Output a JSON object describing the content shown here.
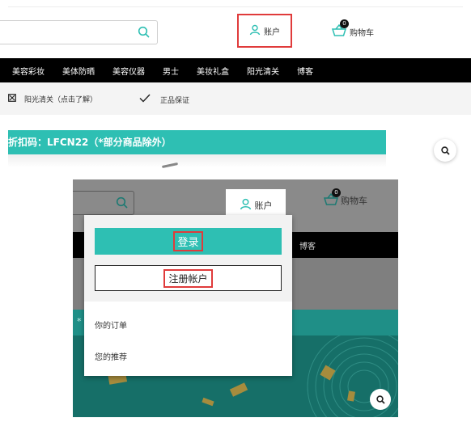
{
  "top": {
    "account_label": "账户",
    "cart_label": "购物车",
    "cart_count": "0",
    "nav_items": [
      "美容彩妆",
      "美体防晒",
      "美容仪器",
      "男士",
      "美妆礼盒",
      "阳光清关",
      "博客"
    ],
    "info_customs": "阳光清关（点击了解）",
    "info_authentic": "正品保证",
    "promo_text": "折扣码：LFCN22（*部分商品除外）"
  },
  "bottom": {
    "account_label": "账户",
    "cart_label": "购物车",
    "cart_count": "0",
    "nav_blog": "博客",
    "band_char": "*",
    "dropdown": {
      "login_label": "登录",
      "register_label": "注册帐户",
      "orders_label": "你的订单",
      "recommend_label": "您的推荐"
    }
  },
  "colors": {
    "teal": "#2ebfb3",
    "highlight": "#e03b3b",
    "nav_bg": "#000000"
  },
  "icons": [
    "search-icon",
    "user-icon",
    "basket-icon",
    "close-box-icon",
    "checkmark-icon"
  ]
}
